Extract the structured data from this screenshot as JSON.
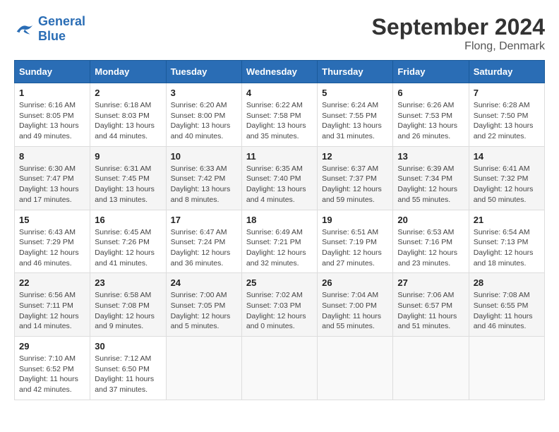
{
  "header": {
    "logo_text1": "General",
    "logo_text2": "Blue",
    "title": "September 2024",
    "subtitle": "Flong, Denmark"
  },
  "columns": [
    "Sunday",
    "Monday",
    "Tuesday",
    "Wednesday",
    "Thursday",
    "Friday",
    "Saturday"
  ],
  "weeks": [
    [
      {
        "day": "1",
        "info": "Sunrise: 6:16 AM\nSunset: 8:05 PM\nDaylight: 13 hours\nand 49 minutes."
      },
      {
        "day": "2",
        "info": "Sunrise: 6:18 AM\nSunset: 8:03 PM\nDaylight: 13 hours\nand 44 minutes."
      },
      {
        "day": "3",
        "info": "Sunrise: 6:20 AM\nSunset: 8:00 PM\nDaylight: 13 hours\nand 40 minutes."
      },
      {
        "day": "4",
        "info": "Sunrise: 6:22 AM\nSunset: 7:58 PM\nDaylight: 13 hours\nand 35 minutes."
      },
      {
        "day": "5",
        "info": "Sunrise: 6:24 AM\nSunset: 7:55 PM\nDaylight: 13 hours\nand 31 minutes."
      },
      {
        "day": "6",
        "info": "Sunrise: 6:26 AM\nSunset: 7:53 PM\nDaylight: 13 hours\nand 26 minutes."
      },
      {
        "day": "7",
        "info": "Sunrise: 6:28 AM\nSunset: 7:50 PM\nDaylight: 13 hours\nand 22 minutes."
      }
    ],
    [
      {
        "day": "8",
        "info": "Sunrise: 6:30 AM\nSunset: 7:47 PM\nDaylight: 13 hours\nand 17 minutes."
      },
      {
        "day": "9",
        "info": "Sunrise: 6:31 AM\nSunset: 7:45 PM\nDaylight: 13 hours\nand 13 minutes."
      },
      {
        "day": "10",
        "info": "Sunrise: 6:33 AM\nSunset: 7:42 PM\nDaylight: 13 hours\nand 8 minutes."
      },
      {
        "day": "11",
        "info": "Sunrise: 6:35 AM\nSunset: 7:40 PM\nDaylight: 13 hours\nand 4 minutes."
      },
      {
        "day": "12",
        "info": "Sunrise: 6:37 AM\nSunset: 7:37 PM\nDaylight: 12 hours\nand 59 minutes."
      },
      {
        "day": "13",
        "info": "Sunrise: 6:39 AM\nSunset: 7:34 PM\nDaylight: 12 hours\nand 55 minutes."
      },
      {
        "day": "14",
        "info": "Sunrise: 6:41 AM\nSunset: 7:32 PM\nDaylight: 12 hours\nand 50 minutes."
      }
    ],
    [
      {
        "day": "15",
        "info": "Sunrise: 6:43 AM\nSunset: 7:29 PM\nDaylight: 12 hours\nand 46 minutes."
      },
      {
        "day": "16",
        "info": "Sunrise: 6:45 AM\nSunset: 7:26 PM\nDaylight: 12 hours\nand 41 minutes."
      },
      {
        "day": "17",
        "info": "Sunrise: 6:47 AM\nSunset: 7:24 PM\nDaylight: 12 hours\nand 36 minutes."
      },
      {
        "day": "18",
        "info": "Sunrise: 6:49 AM\nSunset: 7:21 PM\nDaylight: 12 hours\nand 32 minutes."
      },
      {
        "day": "19",
        "info": "Sunrise: 6:51 AM\nSunset: 7:19 PM\nDaylight: 12 hours\nand 27 minutes."
      },
      {
        "day": "20",
        "info": "Sunrise: 6:53 AM\nSunset: 7:16 PM\nDaylight: 12 hours\nand 23 minutes."
      },
      {
        "day": "21",
        "info": "Sunrise: 6:54 AM\nSunset: 7:13 PM\nDaylight: 12 hours\nand 18 minutes."
      }
    ],
    [
      {
        "day": "22",
        "info": "Sunrise: 6:56 AM\nSunset: 7:11 PM\nDaylight: 12 hours\nand 14 minutes."
      },
      {
        "day": "23",
        "info": "Sunrise: 6:58 AM\nSunset: 7:08 PM\nDaylight: 12 hours\nand 9 minutes."
      },
      {
        "day": "24",
        "info": "Sunrise: 7:00 AM\nSunset: 7:05 PM\nDaylight: 12 hours\nand 5 minutes."
      },
      {
        "day": "25",
        "info": "Sunrise: 7:02 AM\nSunset: 7:03 PM\nDaylight: 12 hours\nand 0 minutes."
      },
      {
        "day": "26",
        "info": "Sunrise: 7:04 AM\nSunset: 7:00 PM\nDaylight: 11 hours\nand 55 minutes."
      },
      {
        "day": "27",
        "info": "Sunrise: 7:06 AM\nSunset: 6:57 PM\nDaylight: 11 hours\nand 51 minutes."
      },
      {
        "day": "28",
        "info": "Sunrise: 7:08 AM\nSunset: 6:55 PM\nDaylight: 11 hours\nand 46 minutes."
      }
    ],
    [
      {
        "day": "29",
        "info": "Sunrise: 7:10 AM\nSunset: 6:52 PM\nDaylight: 11 hours\nand 42 minutes."
      },
      {
        "day": "30",
        "info": "Sunrise: 7:12 AM\nSunset: 6:50 PM\nDaylight: 11 hours\nand 37 minutes."
      },
      {
        "day": "",
        "info": ""
      },
      {
        "day": "",
        "info": ""
      },
      {
        "day": "",
        "info": ""
      },
      {
        "day": "",
        "info": ""
      },
      {
        "day": "",
        "info": ""
      }
    ]
  ]
}
